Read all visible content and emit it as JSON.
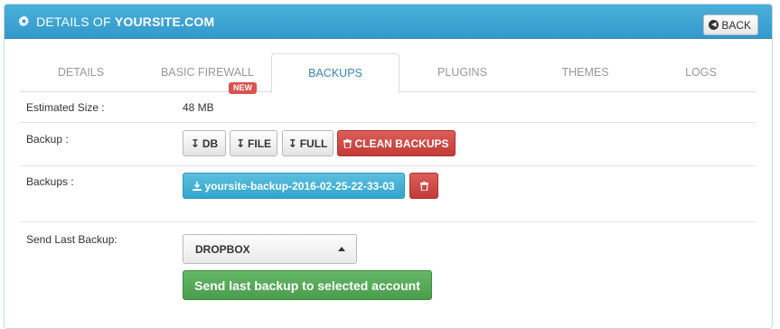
{
  "header": {
    "title_prefix": "DETAILS OF",
    "title_site": "YOURSITE.COM",
    "back_label": "BACK"
  },
  "tabs": [
    {
      "label": "DETAILS",
      "active": false
    },
    {
      "label": "BASIC FIREWALL",
      "active": false,
      "badge": "NEW"
    },
    {
      "label": "BACKUPS",
      "active": true
    },
    {
      "label": "PLUGINS",
      "active": false
    },
    {
      "label": "THEMES",
      "active": false
    },
    {
      "label": "LOGS",
      "active": false
    }
  ],
  "estimated_size": {
    "label": "Estimated Size :",
    "value": "48 MB"
  },
  "backup": {
    "label": "Backup :",
    "db_label": "DB",
    "file_label": "FILE",
    "full_label": "FULL",
    "clean_label": "CLEAN BACKUPS"
  },
  "backups": {
    "label": "Backups :",
    "file_name": "yoursite-backup-2016-02-25-22-33-03"
  },
  "send_last": {
    "label": "Send Last Backup:",
    "selected_option": "DROPBOX",
    "send_label": "Send last backup to selected account"
  },
  "colors": {
    "header": "#3399cc",
    "danger": "#d9534f",
    "info": "#5bc0de",
    "success": "#5cb85c",
    "active_tab_text": "#3a88b5"
  },
  "icons": [
    "gear-icon",
    "back-arrow-icon",
    "sort-icon",
    "trash-icon",
    "download-icon",
    "caret-up-icon"
  ]
}
